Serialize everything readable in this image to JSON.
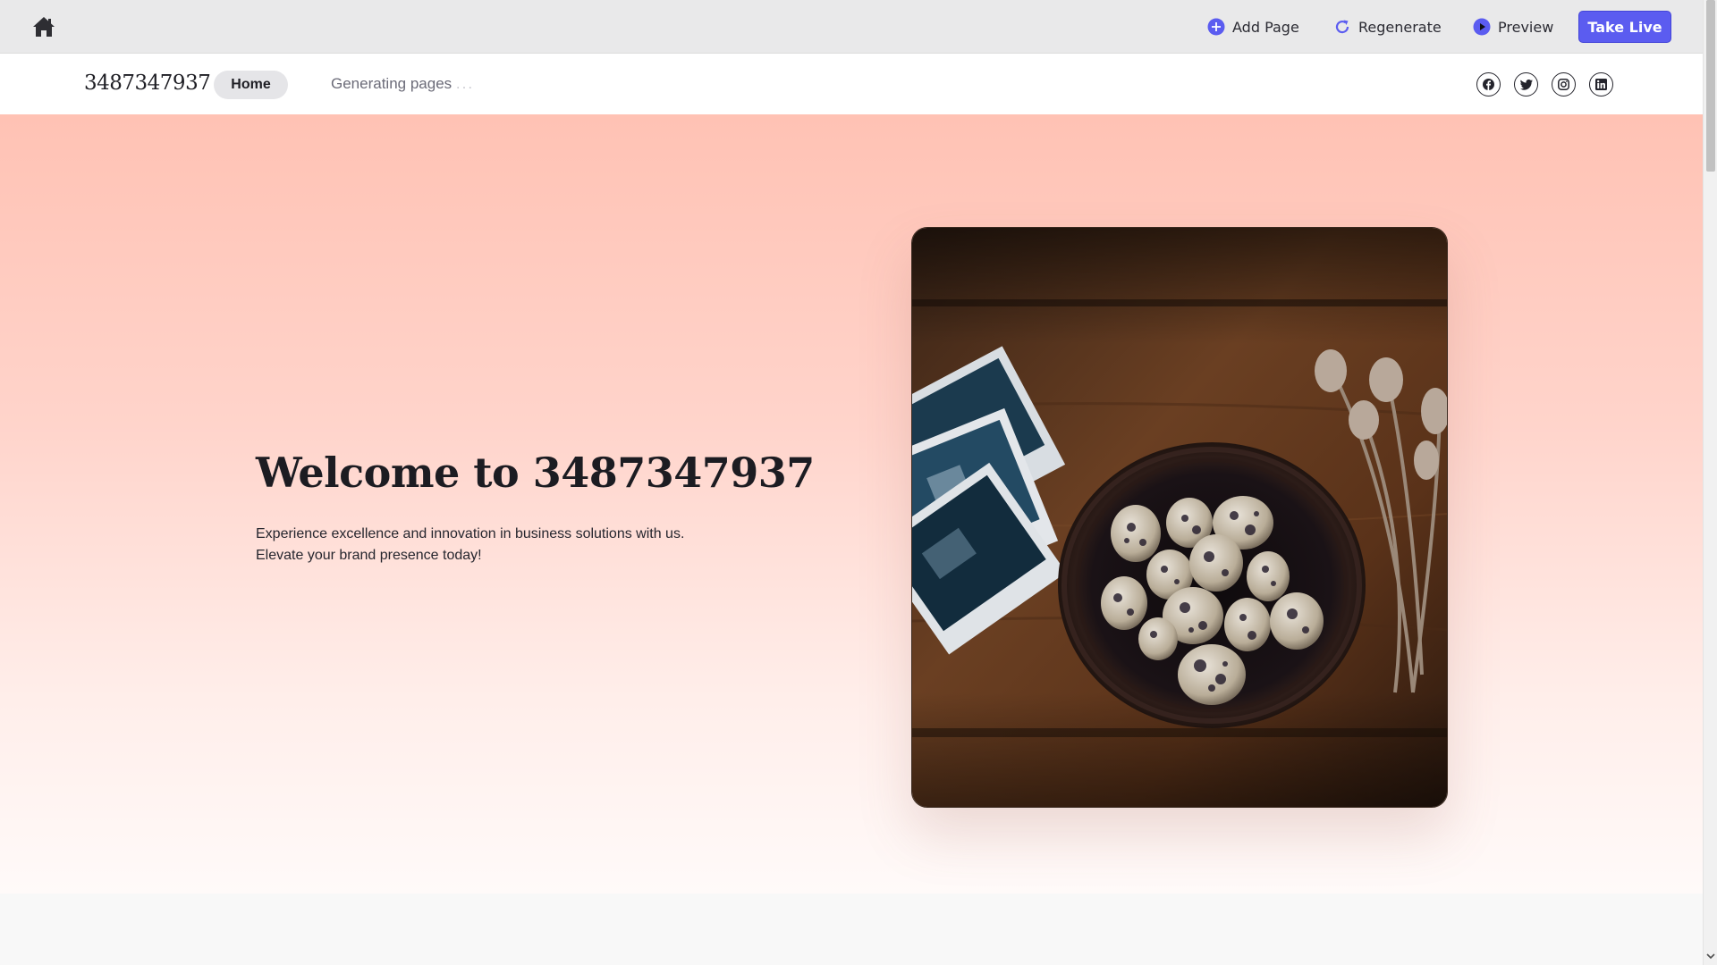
{
  "toolbar": {
    "add_page_label": "Add Page",
    "regenerate_label": "Regenerate",
    "preview_label": "Preview",
    "take_live_label": "Take Live",
    "accent_color": "#5b5cf0"
  },
  "navbar": {
    "brand": "3487347937",
    "home_label": "Home",
    "generating_label": "Generating pages",
    "generating_dots": "...",
    "social_icons": [
      "facebook-icon",
      "twitter-icon",
      "instagram-icon",
      "linkedin-icon"
    ]
  },
  "hero": {
    "title": "Welcome to 3487347937",
    "description": "Experience excellence and innovation in business solutions with us. Elevate your brand presence today!",
    "image_icon": "photo-quail-eggs-nest"
  }
}
